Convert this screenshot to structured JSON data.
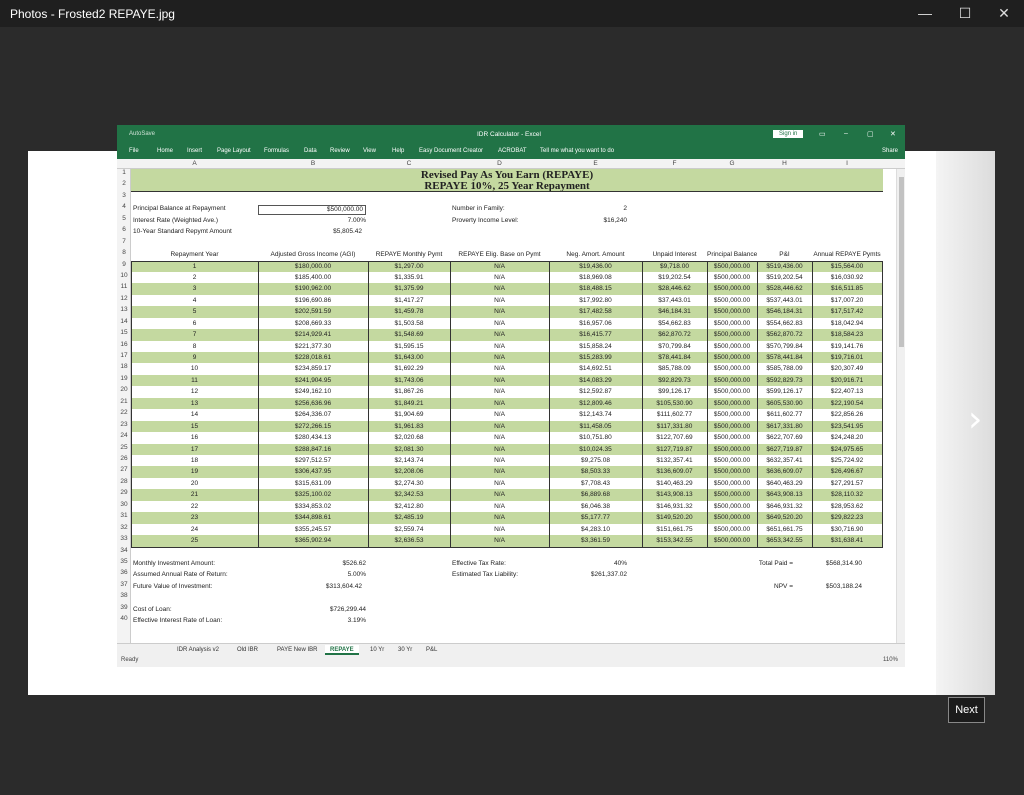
{
  "window": {
    "title": "Photos - Frosted2 REPAYE.jpg",
    "minimize": "—",
    "maximize": "☐",
    "close": "✕"
  },
  "viewer": {
    "next_arrow": "›",
    "next_label": "Next"
  },
  "excel": {
    "title": "IDR Calculator  -  Excel",
    "quick_access": "AutoSave",
    "sign_in": "Sign in",
    "share": "Share",
    "ribbon": [
      "File",
      "Home",
      "Insert",
      "Page Layout",
      "Formulas",
      "Data",
      "Review",
      "View",
      "Help",
      "Easy Document Creator",
      "ACROBAT"
    ],
    "tell_me": "Tell me what you want to do",
    "columns": [
      "A",
      "B",
      "C",
      "D",
      "E",
      "F",
      "G",
      "H",
      "I"
    ],
    "title1": "Revised Pay As You Earn (REPAYE)",
    "title2": "REPAYE 10%, 25 Year Repayment",
    "inputs": {
      "principal_label": "Principal Balance at Repayment",
      "principal": "$500,000.00",
      "rate_label": "Interest Rate (Weighted Ave.)",
      "rate": "7.00%",
      "std_label": "10-Year Standard Repymt Amount",
      "std": "$5,805.42",
      "family_label": "Number in Family:",
      "family": "2",
      "poverty_label": "Proverty Income Level:",
      "poverty": "$16,240"
    },
    "headers": [
      "Repayment Year",
      "Adjusted Gross Income (AGI)",
      "REPAYE Monthly Pymt",
      "REPAYE Elig. Base on Pymt",
      "Neg. Amort. Amount",
      "Unpaid Interest",
      "Principal Balance",
      "P&I",
      "Annual REPAYE Pymts"
    ],
    "rows": [
      [
        "1",
        "$180,000.00",
        "$1,297.00",
        "N/A",
        "$19,436.00",
        "$9,718.00",
        "$500,000.00",
        "$519,436.00",
        "$15,564.00"
      ],
      [
        "2",
        "$185,400.00",
        "$1,335.91",
        "N/A",
        "$18,969.08",
        "$19,202.54",
        "$500,000.00",
        "$519,202.54",
        "$16,030.92"
      ],
      [
        "3",
        "$190,962.00",
        "$1,375.99",
        "N/A",
        "$18,488.15",
        "$28,446.62",
        "$500,000.00",
        "$528,446.62",
        "$16,511.85"
      ],
      [
        "4",
        "$196,690.86",
        "$1,417.27",
        "N/A",
        "$17,992.80",
        "$37,443.01",
        "$500,000.00",
        "$537,443.01",
        "$17,007.20"
      ],
      [
        "5",
        "$202,591.59",
        "$1,459.78",
        "N/A",
        "$17,482.58",
        "$46,184.31",
        "$500,000.00",
        "$546,184.31",
        "$17,517.42"
      ],
      [
        "6",
        "$208,669.33",
        "$1,503.58",
        "N/A",
        "$16,957.06",
        "$54,662.83",
        "$500,000.00",
        "$554,662.83",
        "$18,042.94"
      ],
      [
        "7",
        "$214,929.41",
        "$1,548.69",
        "N/A",
        "$16,415.77",
        "$62,870.72",
        "$500,000.00",
        "$562,870.72",
        "$18,584.23"
      ],
      [
        "8",
        "$221,377.30",
        "$1,595.15",
        "N/A",
        "$15,858.24",
        "$70,799.84",
        "$500,000.00",
        "$570,799.84",
        "$19,141.76"
      ],
      [
        "9",
        "$228,018.61",
        "$1,643.00",
        "N/A",
        "$15,283.99",
        "$78,441.84",
        "$500,000.00",
        "$578,441.84",
        "$19,716.01"
      ],
      [
        "10",
        "$234,859.17",
        "$1,692.29",
        "N/A",
        "$14,692.51",
        "$85,788.09",
        "$500,000.00",
        "$585,788.09",
        "$20,307.49"
      ],
      [
        "11",
        "$241,904.95",
        "$1,743.06",
        "N/A",
        "$14,083.29",
        "$92,829.73",
        "$500,000.00",
        "$592,829.73",
        "$20,916.71"
      ],
      [
        "12",
        "$249,162.10",
        "$1,867.26",
        "N/A",
        "$12,592.87",
        "$99,126.17",
        "$500,000.00",
        "$599,126.17",
        "$22,407.13"
      ],
      [
        "13",
        "$256,636.96",
        "$1,849.21",
        "N/A",
        "$12,809.46",
        "$105,530.90",
        "$500,000.00",
        "$605,530.90",
        "$22,190.54"
      ],
      [
        "14",
        "$264,336.07",
        "$1,904.69",
        "N/A",
        "$12,143.74",
        "$111,602.77",
        "$500,000.00",
        "$611,602.77",
        "$22,856.26"
      ],
      [
        "15",
        "$272,266.15",
        "$1,961.83",
        "N/A",
        "$11,458.05",
        "$117,331.80",
        "$500,000.00",
        "$617,331.80",
        "$23,541.95"
      ],
      [
        "16",
        "$280,434.13",
        "$2,020.68",
        "N/A",
        "$10,751.80",
        "$122,707.69",
        "$500,000.00",
        "$622,707.69",
        "$24,248.20"
      ],
      [
        "17",
        "$288,847.16",
        "$2,081.30",
        "N/A",
        "$10,024.35",
        "$127,719.87",
        "$500,000.00",
        "$627,719.87",
        "$24,975.65"
      ],
      [
        "18",
        "$297,512.57",
        "$2,143.74",
        "N/A",
        "$9,275.08",
        "$132,357.41",
        "$500,000.00",
        "$632,357.41",
        "$25,724.92"
      ],
      [
        "19",
        "$306,437.95",
        "$2,208.06",
        "N/A",
        "$8,503.33",
        "$136,609.07",
        "$500,000.00",
        "$636,609.07",
        "$26,496.67"
      ],
      [
        "20",
        "$315,631.09",
        "$2,274.30",
        "N/A",
        "$7,708.43",
        "$140,463.29",
        "$500,000.00",
        "$640,463.29",
        "$27,291.57"
      ],
      [
        "21",
        "$325,100.02",
        "$2,342.53",
        "N/A",
        "$6,889.68",
        "$143,908.13",
        "$500,000.00",
        "$643,908.13",
        "$28,110.32"
      ],
      [
        "22",
        "$334,853.02",
        "$2,412.80",
        "N/A",
        "$6,046.38",
        "$146,931.32",
        "$500,000.00",
        "$646,931.32",
        "$28,953.62"
      ],
      [
        "23",
        "$344,898.61",
        "$2,485.19",
        "N/A",
        "$5,177.77",
        "$149,520.20",
        "$500,000.00",
        "$649,520.20",
        "$29,822.23"
      ],
      [
        "24",
        "$355,245.57",
        "$2,559.74",
        "N/A",
        "$4,283.10",
        "$151,661.75",
        "$500,000.00",
        "$651,661.75",
        "$30,716.90"
      ],
      [
        "25",
        "$365,902.94",
        "$2,636.53",
        "N/A",
        "$3,361.59",
        "$153,342.55",
        "$500,000.00",
        "$653,342.55",
        "$31,638.41"
      ]
    ],
    "summary": {
      "monthly_label": "Monthly Investment Amount:",
      "monthly": "$526.62",
      "return_label": "Assumed Annual Rate of Return:",
      "return": "5.00%",
      "fv_label": "Future Value of Investment:",
      "fv": "$313,604.42",
      "tax_rate_label": "Effective Tax Rate:",
      "tax_rate": "40%",
      "tax_liab_label": "Estimated Tax Liability:",
      "tax_liab": "$261,337.02",
      "total_label": "Total Paid =",
      "total": "$568,314.90",
      "npv_label": "NPV =",
      "npv": "$503,188.24",
      "cost_label": "Cost of Loan:",
      "cost": "$726,299.44",
      "eff_label": "Effective Interest Rate of Loan:",
      "eff": "3.19%"
    },
    "sheet_tabs": [
      "IDR Analysis v2",
      "Old IBR",
      "PAYE New IBR",
      "REPAYE",
      "10 Yr",
      "30 Yr",
      "P&L"
    ],
    "active_tab": "REPAYE",
    "status": "Ready",
    "zoom": "110%"
  }
}
